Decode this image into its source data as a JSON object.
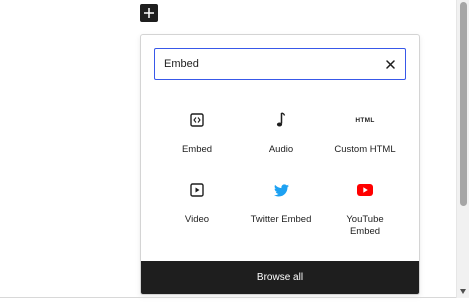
{
  "search": {
    "value": "Embed"
  },
  "blocks": [
    {
      "label": "Embed",
      "icon": "embed-icon"
    },
    {
      "label": "Audio",
      "icon": "music-note-icon"
    },
    {
      "label": "Custom HTML",
      "icon": "html-icon",
      "icon_text": "HTML"
    },
    {
      "label": "Video",
      "icon": "video-icon"
    },
    {
      "label": "Twitter Embed",
      "icon": "twitter-icon",
      "color": "#1da1f2"
    },
    {
      "label": "YouTube Embed",
      "icon": "youtube-icon",
      "color": "#ff0000"
    }
  ],
  "footer": {
    "browse_all_label": "Browse all"
  },
  "colors": {
    "accent": "#3858e9",
    "dark": "#1e1e1e"
  }
}
